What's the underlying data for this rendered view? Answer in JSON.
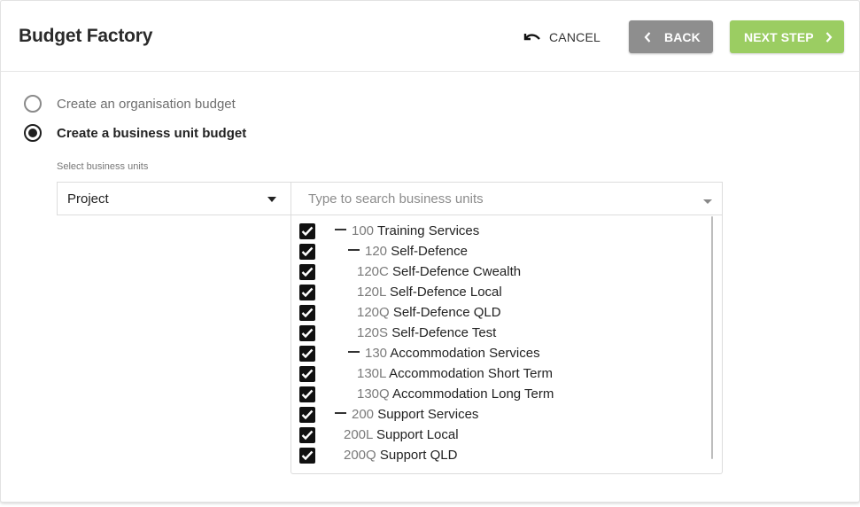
{
  "app": {
    "title": "Budget Factory"
  },
  "header": {
    "cancel_label": "CANCEL",
    "back_label": "BACK",
    "next_label": "NEXT STEP"
  },
  "budget_type": {
    "options": [
      {
        "label": "Create an organisation budget",
        "selected": false
      },
      {
        "label": "Create a business unit budget",
        "selected": true
      }
    ]
  },
  "business_units": {
    "section_label": "Select business units",
    "grouping_select": {
      "value": "Project"
    },
    "search": {
      "placeholder": "Type to search business units",
      "value": ""
    },
    "items": [
      {
        "code": "100",
        "name": "Training Services",
        "level": 0,
        "expanded": true,
        "checked": true
      },
      {
        "code": "120",
        "name": "Self-Defence",
        "level": 1,
        "expanded": true,
        "checked": true
      },
      {
        "code": "120C",
        "name": "Self-Defence Cwealth",
        "level": 2,
        "checked": true
      },
      {
        "code": "120L",
        "name": "Self-Defence Local",
        "level": 2,
        "checked": true
      },
      {
        "code": "120Q",
        "name": "Self-Defence QLD",
        "level": 2,
        "checked": true
      },
      {
        "code": "120S",
        "name": "Self-Defence Test",
        "level": 2,
        "checked": true
      },
      {
        "code": "130",
        "name": "Accommodation Services",
        "level": 1,
        "expanded": true,
        "checked": true
      },
      {
        "code": "130L",
        "name": "Accommodation Short Term",
        "level": 2,
        "checked": true
      },
      {
        "code": "130Q",
        "name": "Accommodation Long Term",
        "level": 2,
        "checked": true
      },
      {
        "code": "200",
        "name": "Support Services",
        "level": 0,
        "expanded": true,
        "checked": true
      },
      {
        "code": "200L",
        "name": "Support Local",
        "level": 1,
        "checked": true
      },
      {
        "code": "200Q",
        "name": "Support QLD",
        "level": 1,
        "checked": true
      }
    ]
  },
  "colors": {
    "back_button": "#8e8e8e",
    "next_button": "#9bcd62",
    "checkbox": "#111111"
  }
}
